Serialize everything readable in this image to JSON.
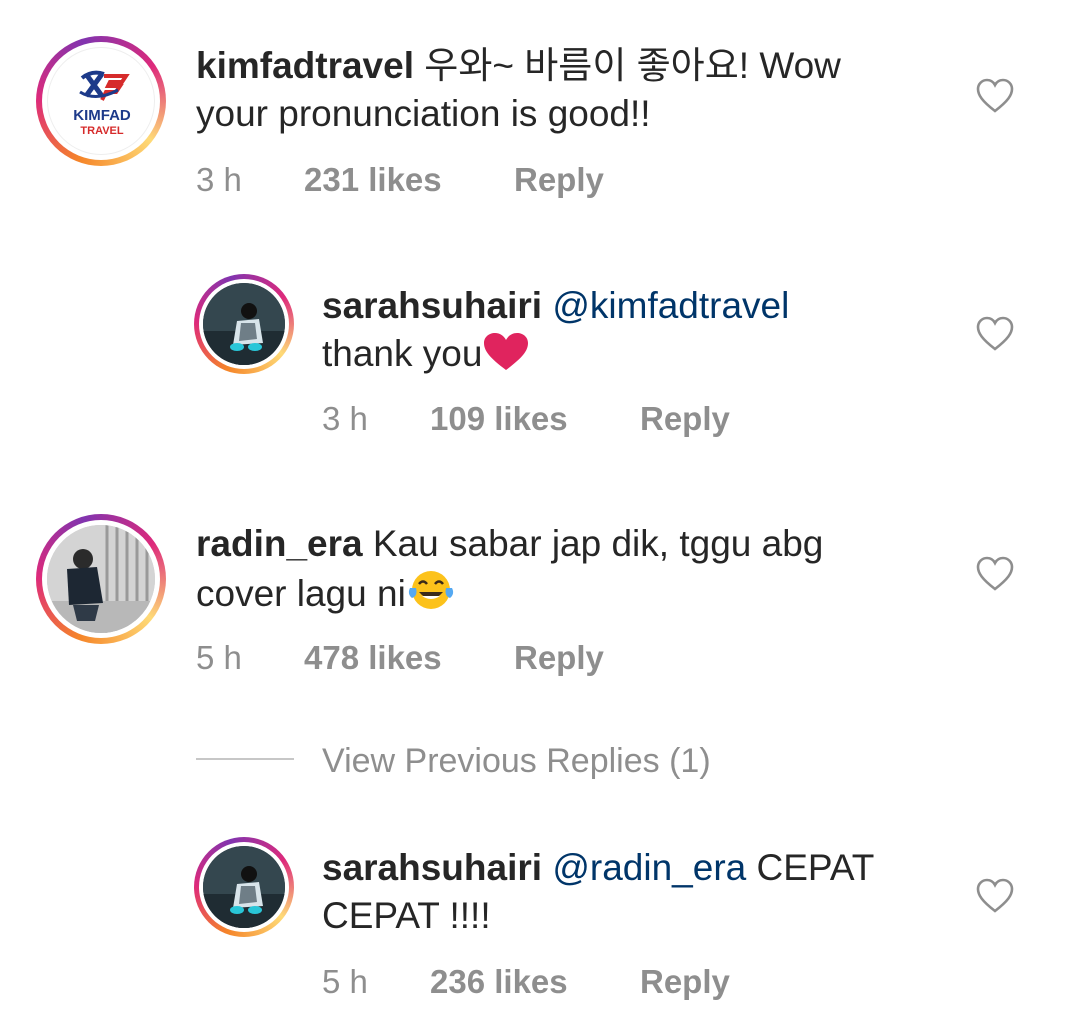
{
  "comments": [
    {
      "username": "kimfadtravel",
      "text": " 우와~ 바름이 좋아요! Wow",
      "text2": "your pronunciation is good!!",
      "time": "3 h",
      "likes": "231 likes",
      "reply": "Reply",
      "avatar_logo_line1": "KIMFAD",
      "avatar_logo_line2": "TRAVEL"
    },
    {
      "username": "sarahsuhairi",
      "mention": "@kimfadtravel",
      "text2": "thank you",
      "time": "3 h",
      "likes": "109 likes",
      "reply": "Reply"
    },
    {
      "username": "radin_era",
      "text": " Kau sabar jap dik, tggu abg",
      "text2": "cover lagu ni",
      "time": "5 h",
      "likes": "478 likes",
      "reply": "Reply"
    },
    {
      "username": "sarahsuhairi",
      "mention": "@radin_era",
      "text": " CEPAT",
      "text2": "CEPAT !!!!",
      "time": "5 h",
      "likes": "236 likes",
      "reply": "Reply"
    }
  ],
  "view_previous_replies": "View Previous Replies (1)",
  "colors": {
    "text": "#262626",
    "muted": "#8e8e8e",
    "mention": "#003569",
    "heart_emoji": "#e0245e"
  }
}
